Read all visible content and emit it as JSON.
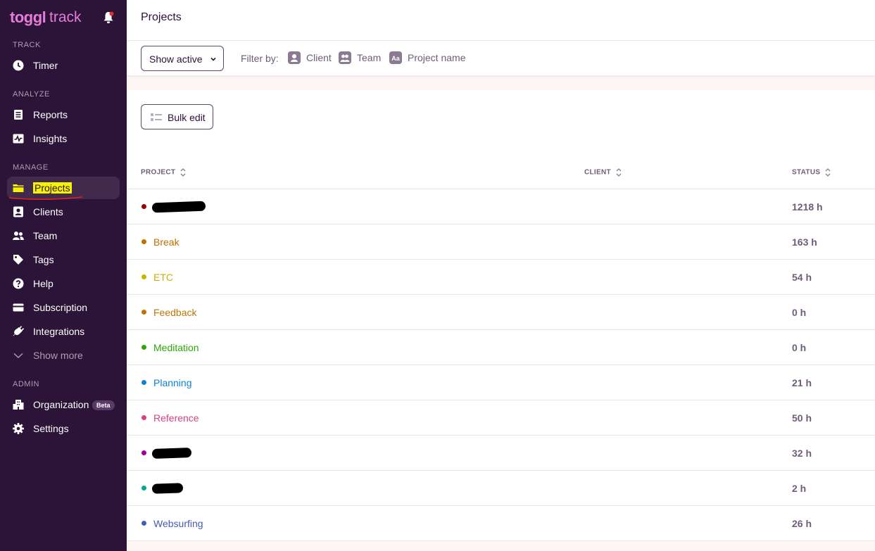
{
  "app": {
    "logo_main": "toggl",
    "logo_sub": "track"
  },
  "sidebar": {
    "sections": {
      "track": "TRACK",
      "analyze": "ANALYZE",
      "manage": "MANAGE",
      "admin": "ADMIN"
    },
    "items": [
      {
        "label": "Timer",
        "icon": "clock-icon"
      },
      {
        "label": "Reports",
        "icon": "report-icon"
      },
      {
        "label": "Insights",
        "icon": "insights-icon"
      },
      {
        "label": "Projects",
        "icon": "folder-icon",
        "active": true
      },
      {
        "label": "Clients",
        "icon": "client-icon"
      },
      {
        "label": "Team",
        "icon": "team-icon"
      },
      {
        "label": "Tags",
        "icon": "tag-icon"
      },
      {
        "label": "Help",
        "icon": "help-icon"
      },
      {
        "label": "Subscription",
        "icon": "card-icon"
      },
      {
        "label": "Integrations",
        "icon": "plug-icon"
      },
      {
        "label": "Show more",
        "icon": "chevron-down-icon"
      },
      {
        "label": "Organization",
        "icon": "building-icon",
        "badge": "Beta"
      },
      {
        "label": "Settings",
        "icon": "gear-icon"
      }
    ]
  },
  "header": {
    "title": "Projects"
  },
  "filters": {
    "status_select": "Show active",
    "filter_by_label": "Filter by:",
    "chips": [
      {
        "label": "Client",
        "icon": "client-icon"
      },
      {
        "label": "Team",
        "icon": "team-icon"
      },
      {
        "label": "Project name",
        "icon": "text-icon"
      }
    ]
  },
  "toolbar": {
    "bulk_edit_label": "Bulk edit"
  },
  "table": {
    "columns": [
      "PROJECT",
      "CLIENT",
      "STATUS"
    ],
    "rows": [
      {
        "name": "",
        "color": "#990000",
        "hours": "1218 h",
        "redacted": true
      },
      {
        "name": "Break",
        "color": "#bf7000",
        "hours": "163 h"
      },
      {
        "name": "ETC",
        "color": "#c9b100",
        "hours": "54 h"
      },
      {
        "name": "Feedback",
        "color": "#c07400",
        "hours": "0 h"
      },
      {
        "name": "Meditation",
        "color": "#2da608",
        "hours": "0 h"
      },
      {
        "name": "Planning",
        "color": "#0b83d9",
        "hours": "21 h"
      },
      {
        "name": "Reference",
        "color": "#d94182",
        "hours": "50 h"
      },
      {
        "name": "",
        "color": "#9e0099",
        "hours": "32 h",
        "redacted": true
      },
      {
        "name": "",
        "color": "#06a893",
        "hours": "2 h",
        "redacted": true
      },
      {
        "name": "Websurfing",
        "color": "#465bb3",
        "hours": "26 h"
      }
    ]
  }
}
